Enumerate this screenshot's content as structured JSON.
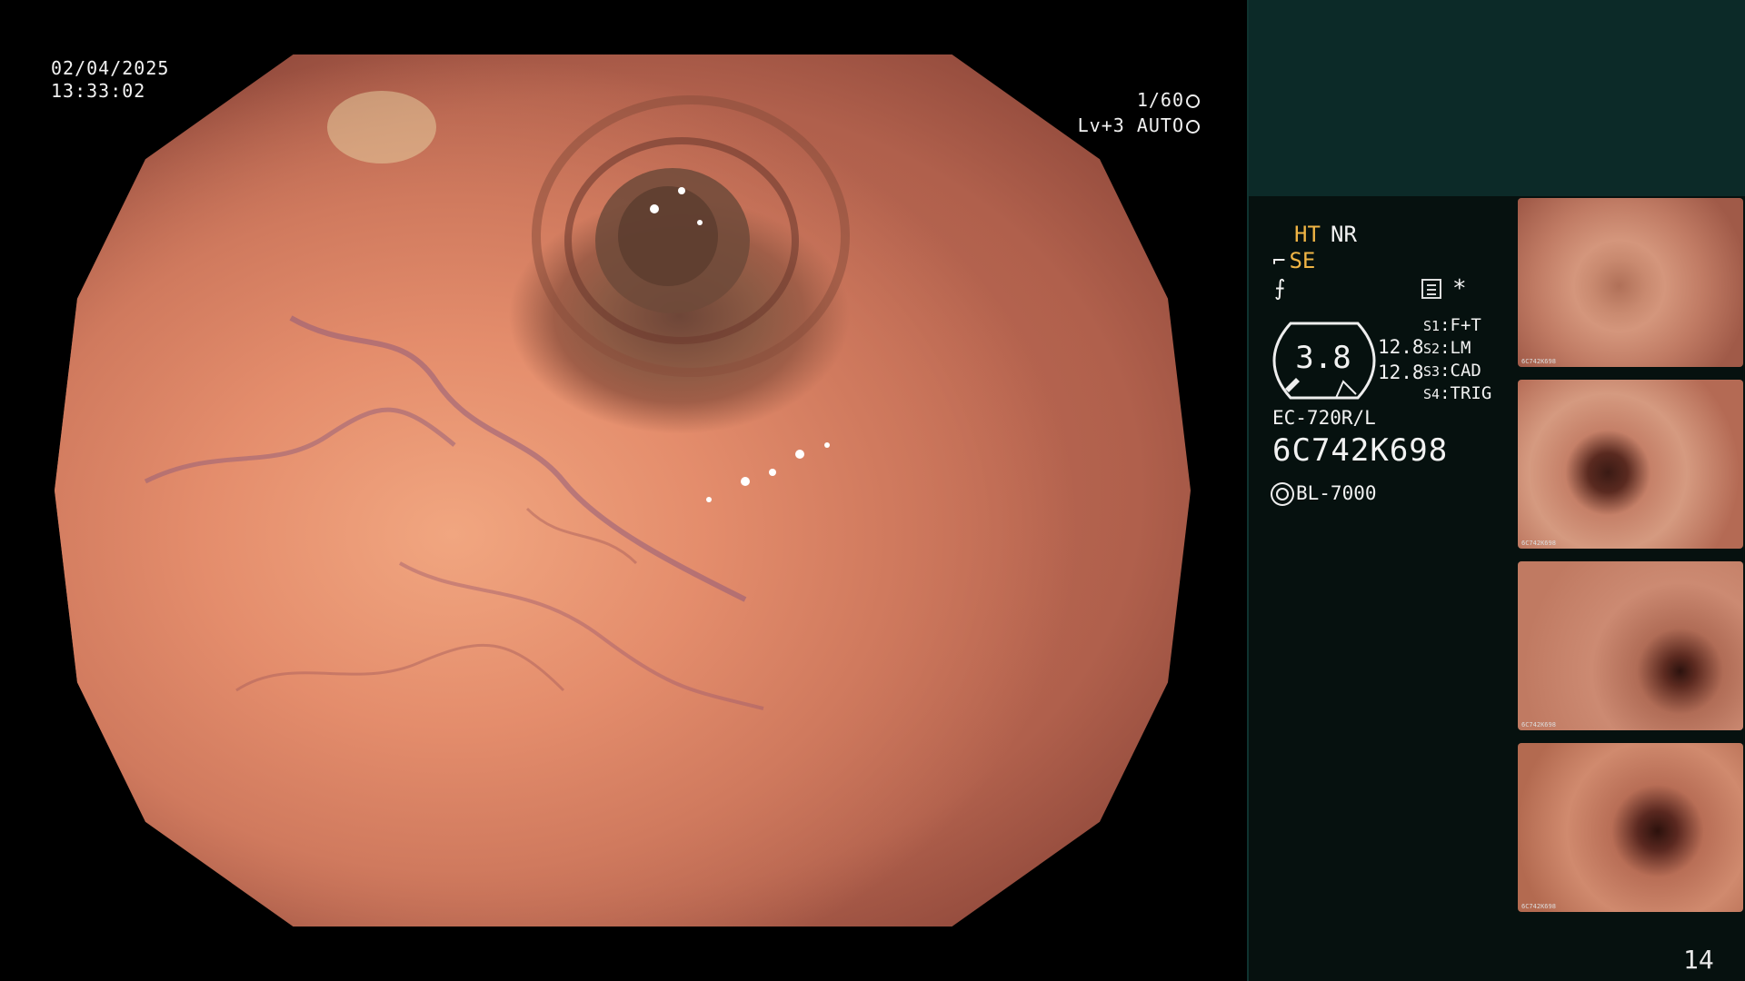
{
  "overlay": {
    "date": "02/04/2025",
    "time": "13:33:02",
    "shutter": "1/60",
    "level": "Lv+3 AUTO"
  },
  "panel": {
    "ht": "HT",
    "nr": "NR",
    "se": "SE",
    "gauge_value": "3.8",
    "gauge_val_a": "12.8",
    "gauge_val_b": "12.8",
    "slots": [
      {
        "key": "S1",
        "value": "F+T"
      },
      {
        "key": "S2",
        "value": "LM"
      },
      {
        "key": "S3",
        "value": "CAD"
      },
      {
        "key": "S4",
        "value": "TRIG"
      }
    ],
    "scope_model": "EC-720R/L",
    "scope_serial": "6C742K698",
    "light_source": "BL-7000",
    "asterisk": "*",
    "page_number": "14"
  },
  "thumbnails": [
    {
      "caption": "6C742K698"
    },
    {
      "caption": "6C742K698"
    },
    {
      "caption": "6C742K698"
    },
    {
      "caption": "6C742K698"
    }
  ],
  "colors": {
    "panel_top": "#0c2a28",
    "panel_bottom": "#06110f",
    "accent_yellow": "#f0b545",
    "text": "#f2f2f2"
  }
}
